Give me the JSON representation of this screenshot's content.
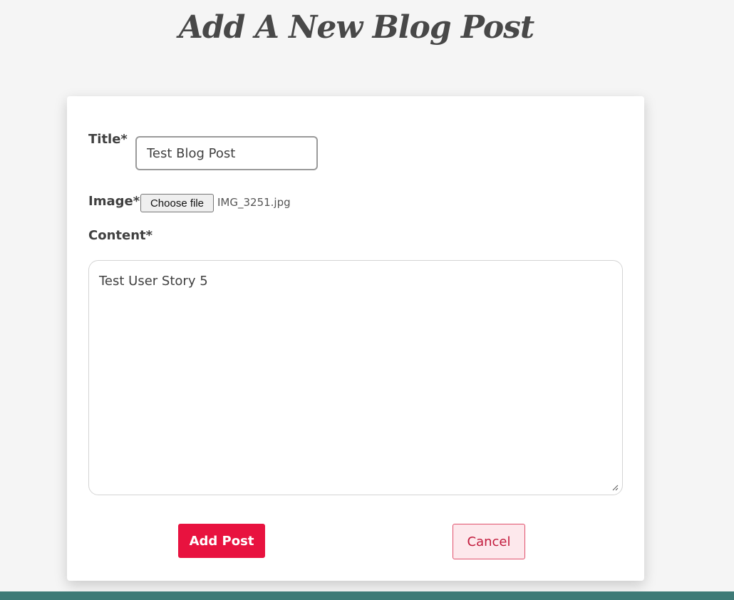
{
  "page": {
    "title": "Add A New Blog Post"
  },
  "form": {
    "title_label": "Title*",
    "title_value": "Test Blog Post",
    "image_label": "Image*",
    "file_button_label": "Choose file",
    "file_name": "IMG_3251.jpg",
    "content_label": "Content*",
    "content_value": "Test User Story 5",
    "submit_label": "Add Post",
    "cancel_label": "Cancel"
  },
  "colors": {
    "background": "#f5f5f5",
    "card": "#ffffff",
    "primary": "#e8123f",
    "cancel_bg": "#fde8ec",
    "cancel_text": "#c21a3c",
    "footer": "#3e7a76"
  }
}
